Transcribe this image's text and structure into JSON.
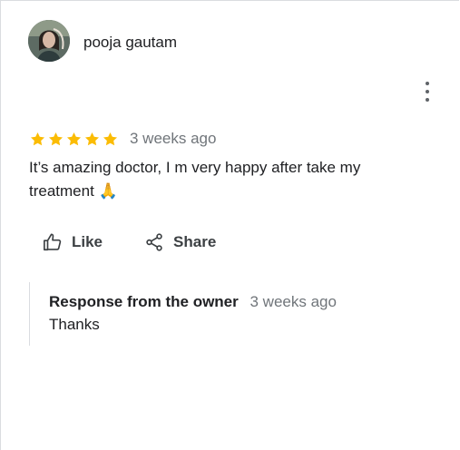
{
  "review": {
    "author_name": "pooja gautam",
    "rating": 5,
    "date": "3 weeks ago",
    "text_line1": "It’s amazing doctor, I m very happy after take my",
    "text_line2": "treatment 🙏"
  },
  "actions": {
    "like_label": "Like",
    "share_label": "Share"
  },
  "owner_response": {
    "title": "Response from the owner",
    "date": "3 weeks ago",
    "text": "Thanks"
  },
  "colors": {
    "star": "#fbbc04",
    "muted_text": "#70757a",
    "primary_text": "#202124"
  },
  "icons": {
    "more": "more-vertical-icon",
    "like": "thumb-up-icon",
    "share": "share-icon",
    "star": "star-icon"
  }
}
